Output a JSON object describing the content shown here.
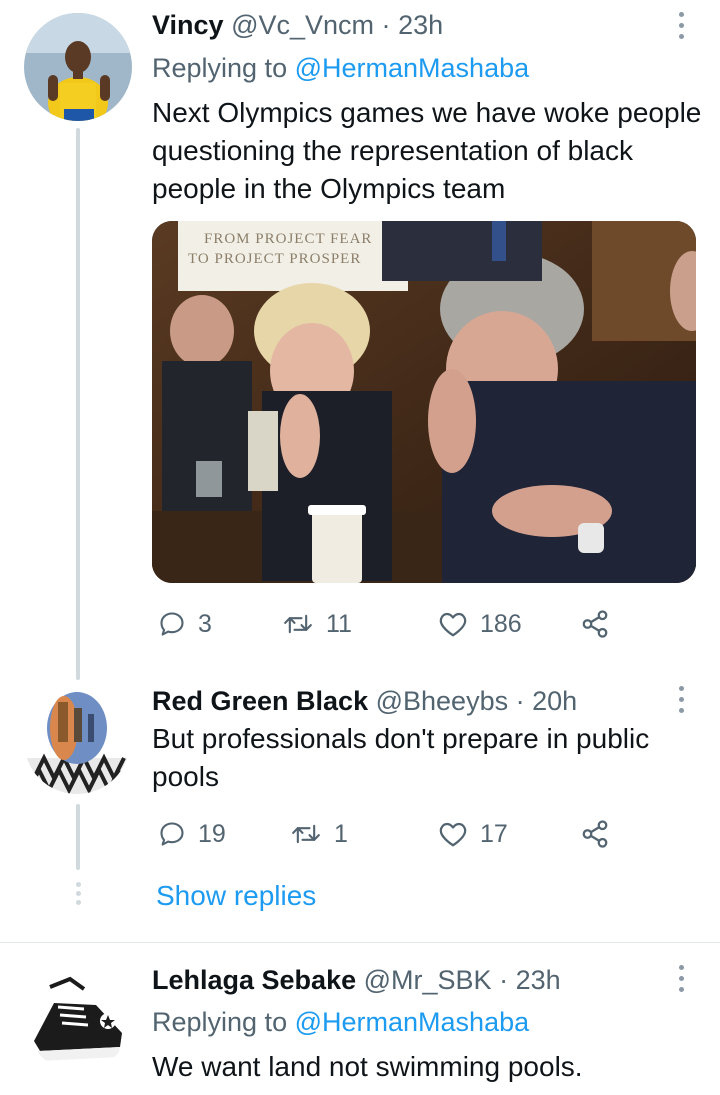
{
  "tweets": [
    {
      "name": "Vincy",
      "handle": "@Vc_Vncm",
      "dot": "·",
      "time": "23h",
      "replying_prefix": "Replying to",
      "replying_to": "@HermanMashaba",
      "text": "Next Olympics games we have woke people questioning the representation of black people in the Olympics team",
      "media_sign_line1": "FROM PROJECT FEAR",
      "media_sign_line2": "TO PROJECT PROSPER",
      "stats": {
        "replies": "3",
        "retweets": "11",
        "likes": "186"
      }
    },
    {
      "name": "Red Green Black",
      "handle": "@Bheeybs",
      "dot": "·",
      "time": "20h",
      "text": "But professionals don't prepare in public pools",
      "stats": {
        "replies": "19",
        "retweets": "1",
        "likes": "17"
      }
    },
    {
      "name": "Lehlaga Sebake",
      "handle": "@Mr_SBK",
      "dot": "·",
      "time": "23h",
      "replying_prefix": "Replying to",
      "replying_to": "@HermanMashaba",
      "text": "We want land not swimming pools."
    }
  ],
  "show_replies_label": "Show replies",
  "icons": [
    "reply-icon",
    "retweet-icon",
    "like-icon",
    "share-icon",
    "more-icon"
  ],
  "colors": {
    "accent": "#1d9bf0",
    "secondary_text": "#536471",
    "thread_line": "#cfd9de"
  }
}
